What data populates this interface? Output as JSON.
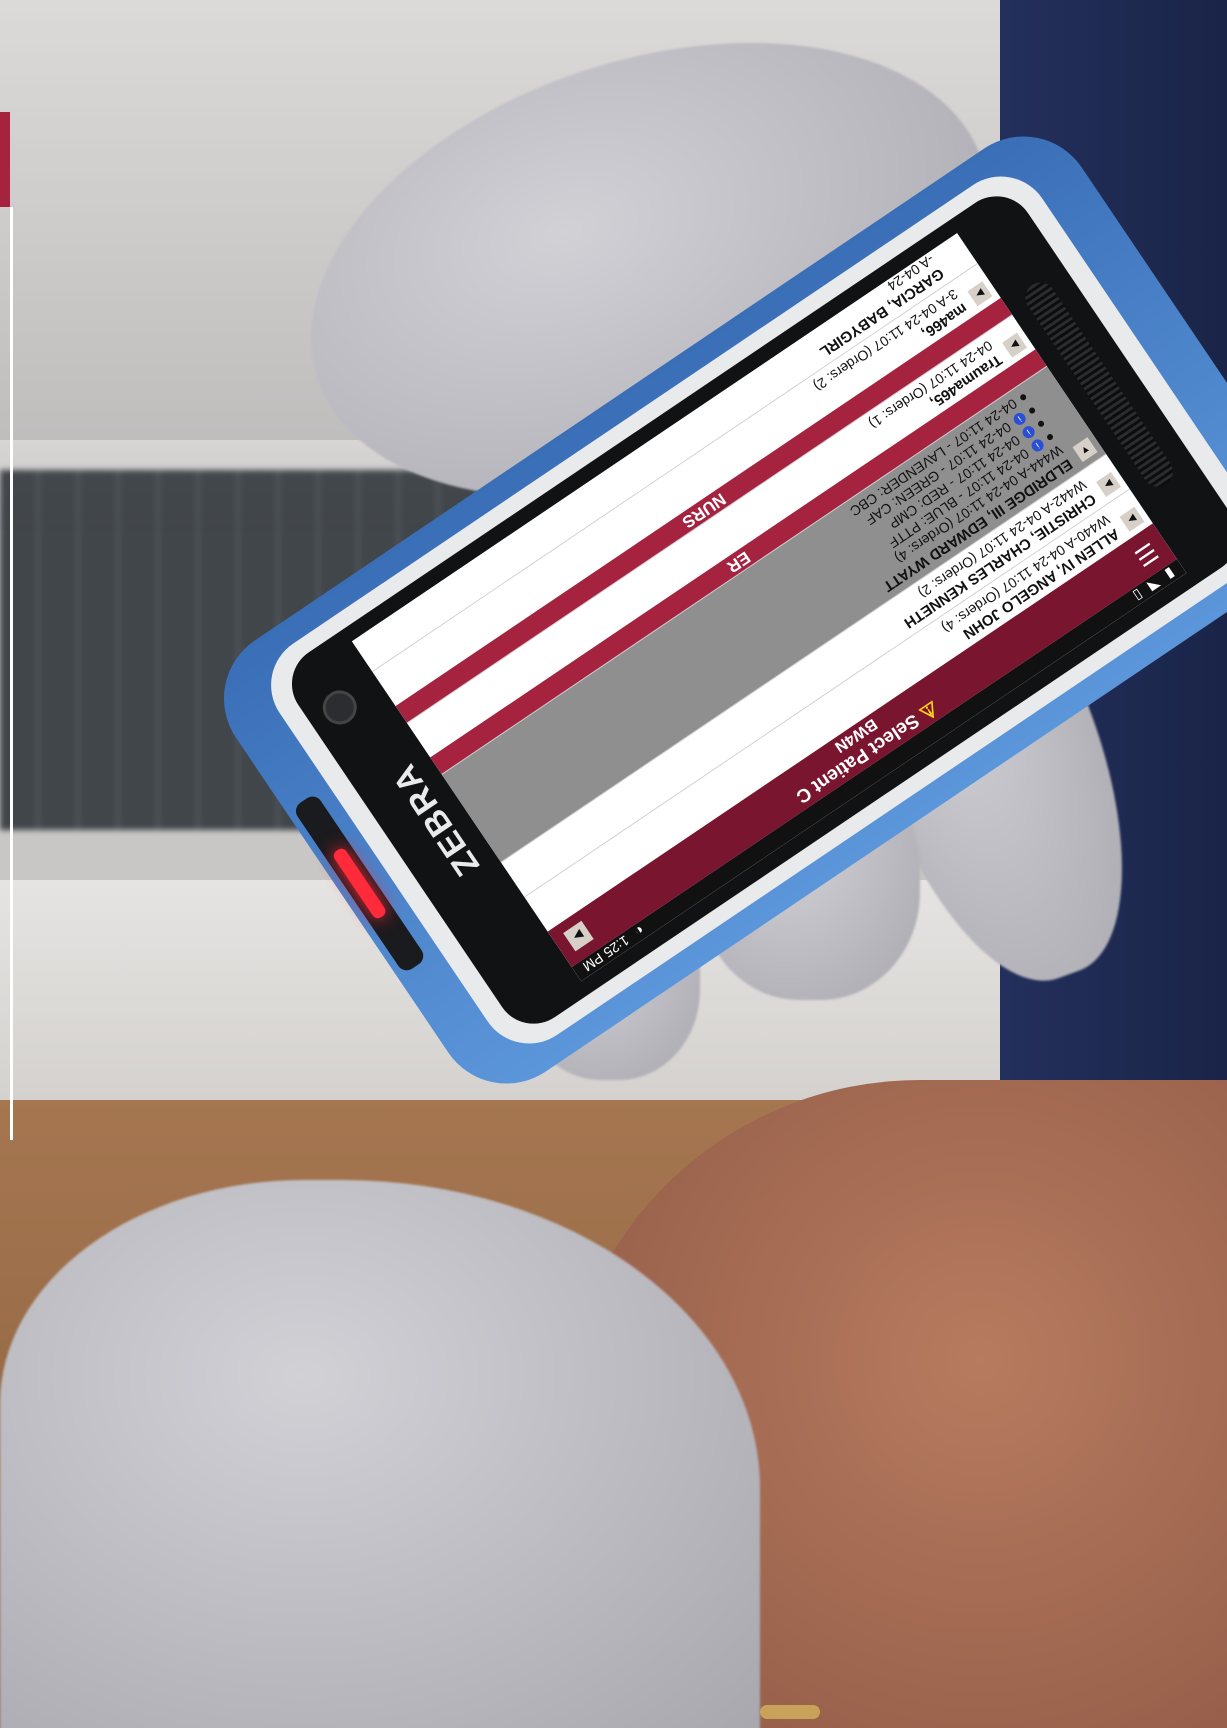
{
  "status_bar": {
    "time": "1:25 PM"
  },
  "app_bar": {
    "title": "Select Patient C",
    "subtitle": "BW4N"
  },
  "groups": [
    {
      "patients": [
        {
          "name": "ALLEN IV, ANGELO JOHN",
          "meta": "W440-A 04-24 11:07 (Orders: 4)"
        },
        {
          "name": "CHRISTIE, CHARLES KENNETH",
          "meta": "W442-A 04-24 11:07 (Orders: 2)"
        },
        {
          "name": "ELDRIDGE III, EDWARD WYATT",
          "meta": "W444-A 04-24 11:07 (Orders: 4)",
          "selected": true,
          "orders": [
            "04-24 11:07 - BLUE: PTTF",
            "04-24 11:07 - RED: CMP",
            "04-24 11:07 - GREEN: CAF",
            "04-24 11:07 - LAVENDER: CBC"
          ]
        }
      ]
    },
    {
      "label": "ER",
      "patients": [
        {
          "name": "Trauma465,",
          "meta": "04-24 11:07 (Orders: 1)"
        }
      ]
    },
    {
      "label": "NURS",
      "patients": [
        {
          "name": "ma466,",
          "meta": "3-A 04-24 11:07 (Orders: 2)"
        },
        {
          "name": "GARCIA, BABYGIRL",
          "meta": "-A 04-24"
        }
      ]
    }
  ],
  "device": {
    "brand": "ZEBRA"
  },
  "colors": {
    "app_bar": "#7a1530",
    "group_header": "#a5233f",
    "case": "#4a84cc"
  },
  "icons": {
    "menu": "hamburger-icon",
    "warning": "warning-icon",
    "expand": "expand-arrow-icon",
    "info": "info-icon",
    "back": "back-icon",
    "home": "home-icon",
    "recents": "recents-icon"
  }
}
